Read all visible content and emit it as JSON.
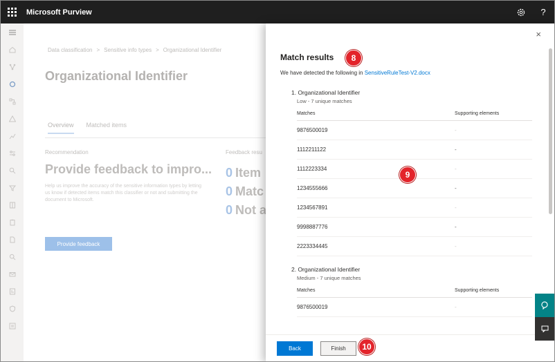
{
  "app": {
    "title": "Microsoft Purview"
  },
  "topbar": {
    "settings_icon": "gear-icon",
    "help_label": "?"
  },
  "nav": {
    "icons": [
      "hamburger-icon",
      "home-icon",
      "network-icon",
      "data-class-icon",
      "flow-icon",
      "alert-icon",
      "chart-icon",
      "settings-lines-icon",
      "search-tag-icon",
      "filter-icon",
      "book-icon",
      "clipboard-icon",
      "document-icon",
      "search-icon",
      "mail-icon",
      "report-icon",
      "policy-icon",
      "list-icon"
    ]
  },
  "background": {
    "breadcrumb": [
      "Data classification",
      ">",
      "Sensitive info types",
      ">",
      "Organizational Identifier"
    ],
    "title": "Organizational Identifier",
    "tabs": [
      "Overview",
      "Matched items"
    ],
    "recommendation_label": "Recommendation",
    "recommendation_heading": "Provide feedback to impro...",
    "recommendation_body": "Help us improve the accuracy of the sensitive information types by letting us know if detected items match this classifier or not and submitting the document to Microsoft.",
    "feedback_label": "Feedback resu",
    "feedback_rows": [
      {
        "num": "0",
        "text": "Item"
      },
      {
        "num": "0",
        "text": "Matc"
      },
      {
        "num": "0",
        "text": "Not a"
      }
    ],
    "provide_button": "Provide feedback"
  },
  "panel": {
    "close": "×",
    "title": "Match results",
    "detected_prefix": "We have detected the following in ",
    "detected_file": "SensitiveRuleTest-V2.docx",
    "col_matches": "Matches",
    "col_supporting": "Supporting elements",
    "groups": [
      {
        "title": "1. Organizational Identifier",
        "subtitle": "Low - 7 unique matches",
        "rows": [
          {
            "match": "9876500019",
            "support": "-"
          },
          {
            "match": "1112211122",
            "support": "-"
          },
          {
            "match": "1112223334",
            "support": "-"
          },
          {
            "match": "1234555666",
            "support": "-"
          },
          {
            "match": "1234567891",
            "support": "-"
          },
          {
            "match": "9998887776",
            "support": "-"
          },
          {
            "match": "2223334445",
            "support": "-"
          }
        ]
      },
      {
        "title": "2. Organizational Identifier",
        "subtitle": "Medium - 7 unique matches",
        "rows": [
          {
            "match": "9876500019",
            "support": "-"
          }
        ]
      }
    ],
    "back_button": "Back",
    "finish_button": "Finish"
  },
  "callouts": [
    "8",
    "9",
    "10"
  ],
  "side_buttons": {
    "first_color": "#038387",
    "second_color": "#323130"
  },
  "colors": {
    "accent": "#0078d4",
    "topbar": "#1f1f1f",
    "callout": "#e3242b"
  }
}
